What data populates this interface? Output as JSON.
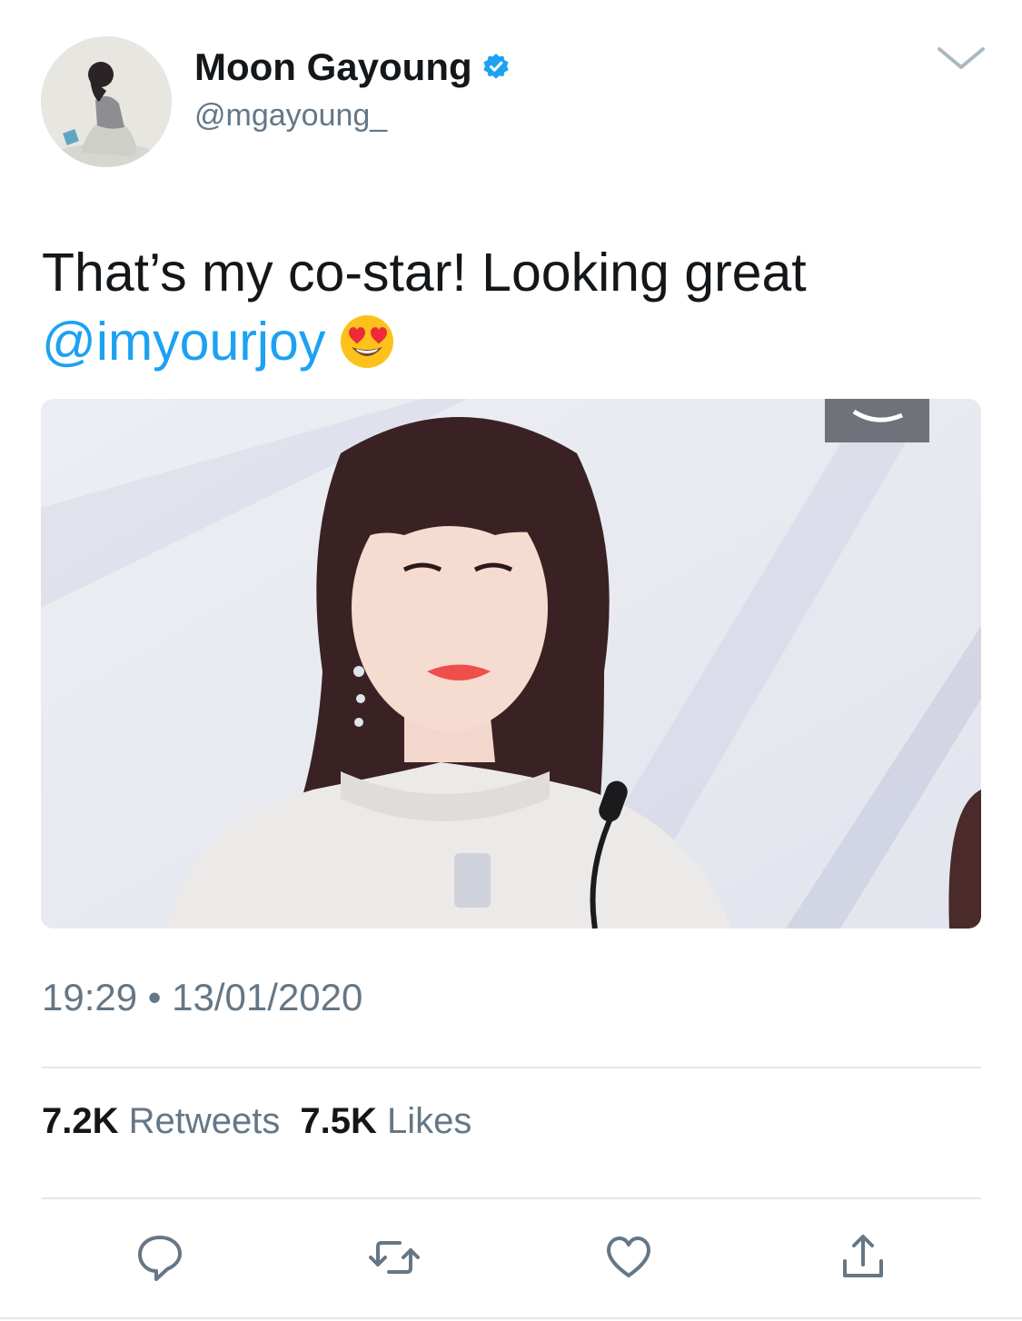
{
  "tweet": {
    "display_name": "Moon Gayoung",
    "handle": "@mgayoung_",
    "text": "That’s my co-star! Looking great",
    "mention": "@imyourjoy",
    "emoji": "smiling-face-with-heart-eyes",
    "time": "19:29",
    "separator": "•",
    "date": "13/01/2020"
  },
  "stats": {
    "retweets_count": "7.2K",
    "retweets_label": "Retweets",
    "likes_count": "7.5K",
    "likes_label": "Likes"
  },
  "icons": {
    "verified": "verified-badge-icon",
    "menu": "chevron-down-icon",
    "reply": "reply-icon",
    "retweet": "retweet-icon",
    "like": "heart-icon",
    "share": "share-icon"
  },
  "colors": {
    "link": "#1da1f2",
    "text_primary": "#14171a",
    "text_secondary": "#657786",
    "divider": "#e1e8ed"
  }
}
